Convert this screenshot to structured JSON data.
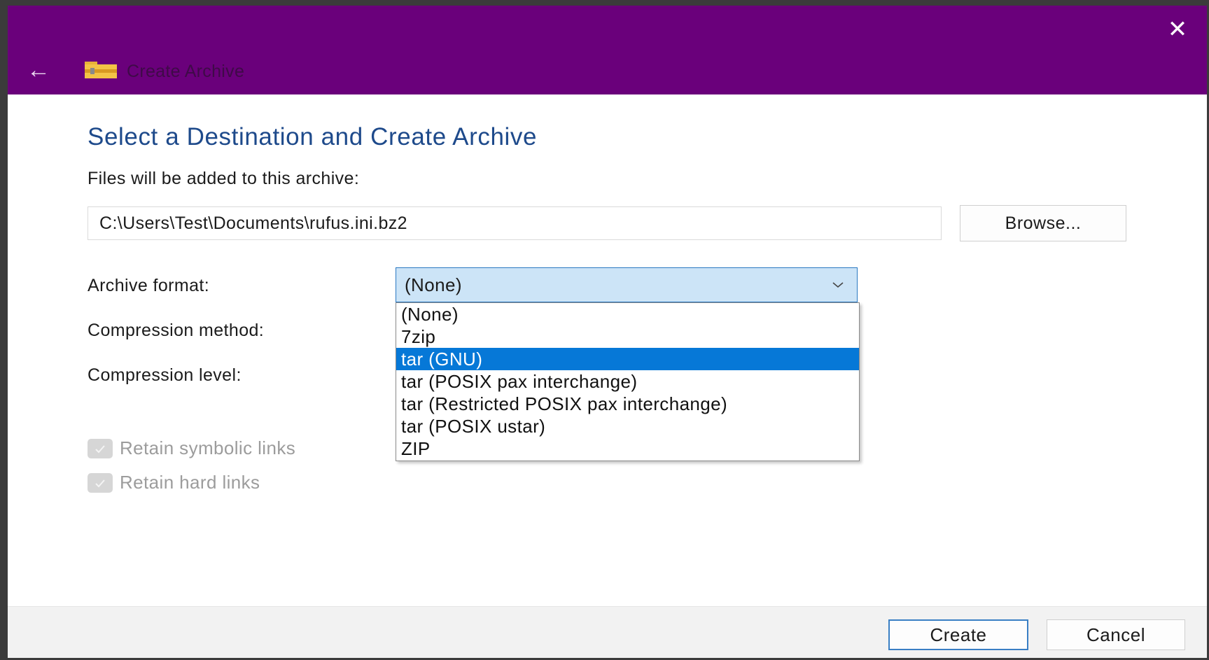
{
  "window": {
    "title": "Create Archive",
    "back_icon": "back-arrow-icon",
    "close_icon": "close-icon",
    "app_icon": "archive-folder-icon",
    "title_bar_color": "#6a007b"
  },
  "main": {
    "heading": "Select a Destination and Create Archive",
    "files_label": "Files will be added to this archive:",
    "archive_path": "C:\\Users\\Test\\Documents\\rufus.ini.bz2",
    "browse_label": "Browse...",
    "archive_format_label": "Archive format:",
    "compression_method_label": "Compression method:",
    "compression_level_label": "Compression level:",
    "archive_format_selected": "(None)",
    "archive_format_options": [
      "(None)",
      "7zip",
      "tar (GNU)",
      "tar (POSIX pax interchange)",
      "tar (Restricted POSIX pax interchange)",
      "tar (POSIX ustar)",
      "ZIP"
    ],
    "highlighted_option": "tar (GNU)",
    "retain_symbolic_links_label": "Retain symbolic links",
    "retain_hard_links_label": "Retain hard links"
  },
  "footer": {
    "create_label": "Create",
    "cancel_label": "Cancel"
  }
}
